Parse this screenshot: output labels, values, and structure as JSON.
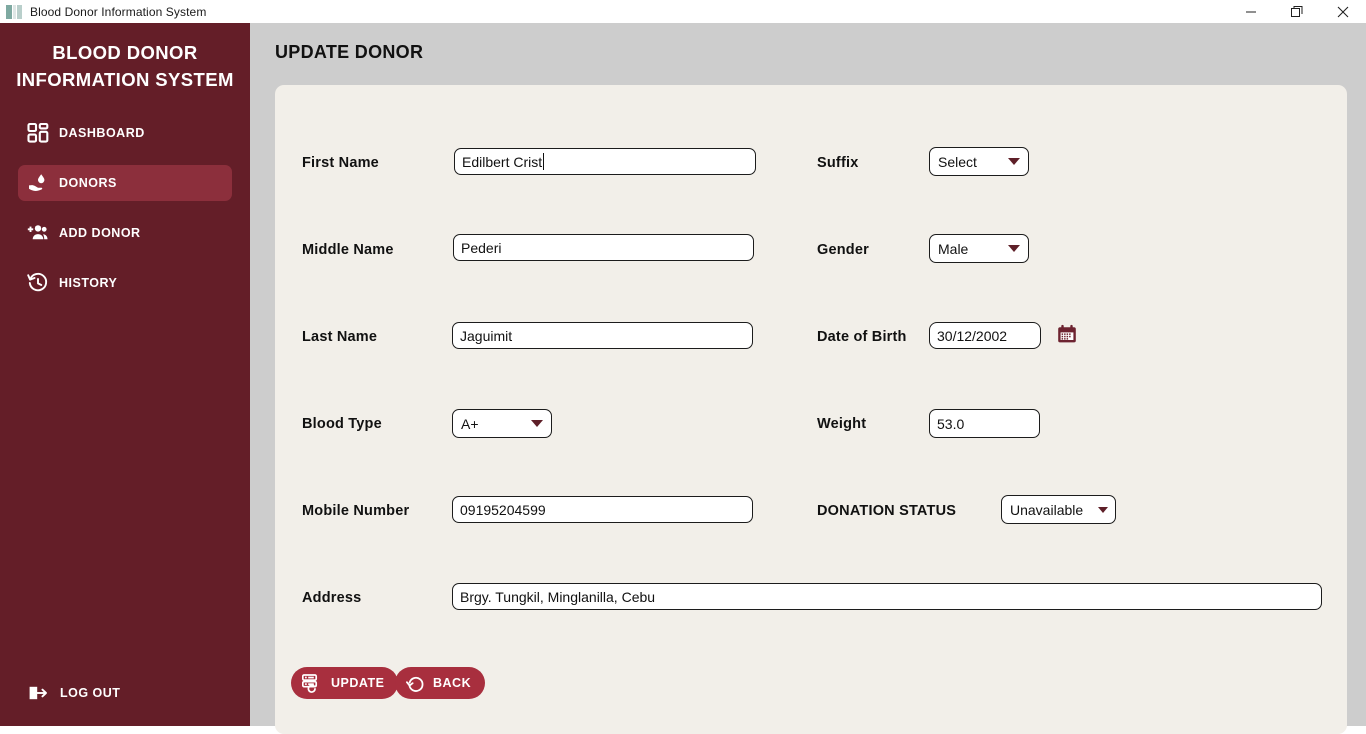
{
  "window": {
    "title": "Blood Donor Information System",
    "app_icon": "app-icon",
    "controls": {
      "minimize": "minimize-icon",
      "maximize": "maximize-icon",
      "close": "close-icon"
    }
  },
  "sidebar": {
    "brand_line1": "BLOOD DONOR",
    "brand_line2": "INFORMATION SYSTEM",
    "items": [
      {
        "label": "DASHBOARD",
        "icon": "dashboard-grid-icon",
        "active": false
      },
      {
        "label": "DONORS",
        "icon": "blood-drop-hand-icon",
        "active": true
      },
      {
        "label": "ADD DONOR",
        "icon": "add-user-icon",
        "active": false
      },
      {
        "label": "HISTORY",
        "icon": "clock-history-icon",
        "active": false
      }
    ],
    "logout": {
      "label": "LOG OUT",
      "icon": "logout-icon"
    },
    "bg_color": "#641e28",
    "active_color": "#8c2f3c"
  },
  "main": {
    "page_title": "UPDATE DONOR",
    "background_color": "#cdcdcd",
    "card_color": "#f2efe9"
  },
  "form": {
    "first_name": {
      "label": "First Name",
      "value": "Edilbert Crist",
      "focused": true
    },
    "middle_name": {
      "label": "Middle Name",
      "value": "Pederi"
    },
    "last_name": {
      "label": "Last Name",
      "value": "Jaguimit"
    },
    "blood_type": {
      "label": "Blood Type",
      "value": "A+"
    },
    "mobile_number": {
      "label": "Mobile Number",
      "value": "09195204599"
    },
    "address": {
      "label": "Address",
      "value": "Brgy. Tungkil, Minglanilla, Cebu"
    },
    "suffix": {
      "label": "Suffix",
      "value": "Select"
    },
    "gender": {
      "label": "Gender",
      "value": "Male"
    },
    "date_of_birth": {
      "label": "Date of Birth",
      "value": "30/12/2002",
      "icon": "calendar-icon"
    },
    "weight": {
      "label": "Weight",
      "value": "53.0"
    },
    "donation_status": {
      "label": "DONATION STATUS",
      "value": "Unavailable"
    }
  },
  "actions": {
    "update": {
      "label": "UPDATE",
      "icon": "database-refresh-icon"
    },
    "back": {
      "label": "BACK",
      "icon": "undo-arrow-icon"
    },
    "color": "#a82f3e"
  }
}
